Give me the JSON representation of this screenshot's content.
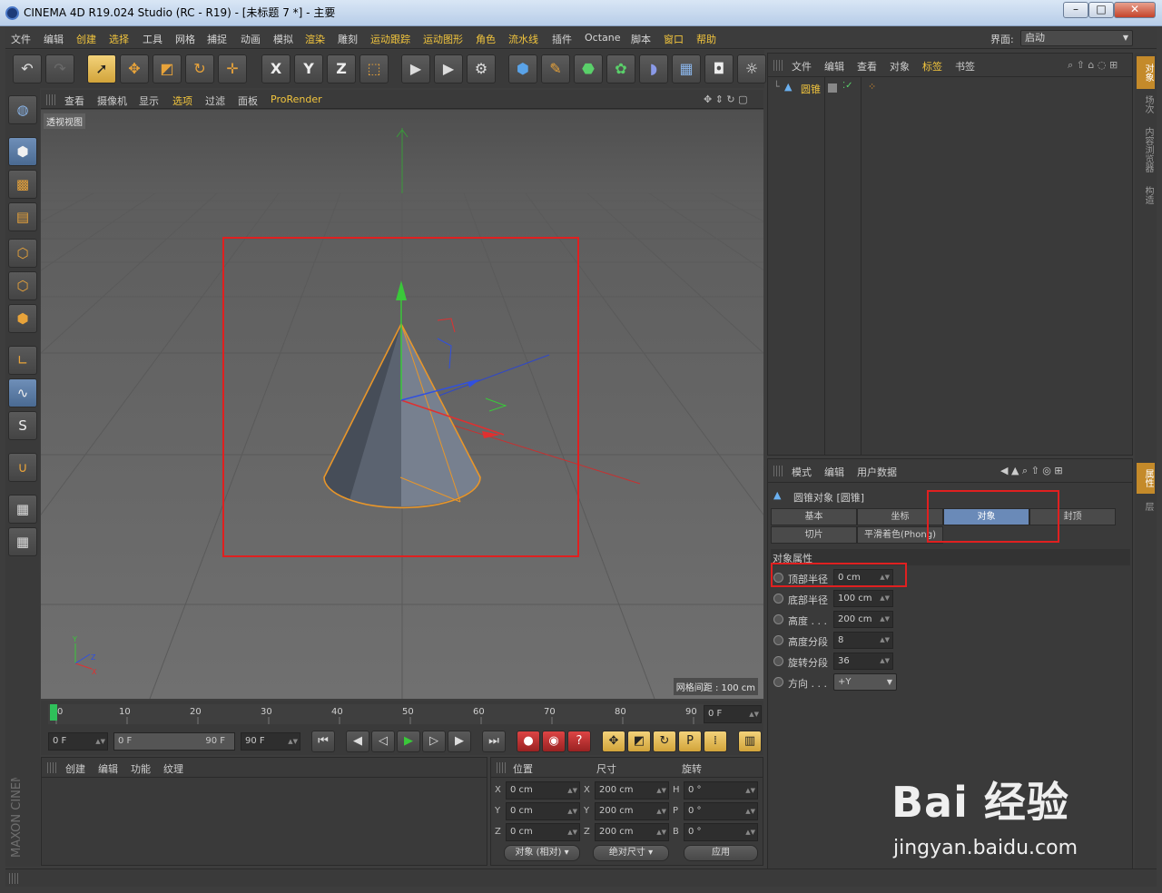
{
  "window": {
    "title": "CINEMA 4D R19.024 Studio (RC - R19) - [未标题 7 *] - 主要",
    "minimize": "–",
    "maximize": "□",
    "close": "✕"
  },
  "menubar": {
    "items": [
      {
        "label": "文件"
      },
      {
        "label": "编辑"
      },
      {
        "label": "创建"
      },
      {
        "label": "选择"
      },
      {
        "label": "工具"
      },
      {
        "label": "网格"
      },
      {
        "label": "捕捉"
      },
      {
        "label": "动画"
      },
      {
        "label": "模拟"
      },
      {
        "label": "渲染"
      },
      {
        "label": "雕刻"
      },
      {
        "label": "运动跟踪"
      },
      {
        "label": "运动图形"
      },
      {
        "label": "角色"
      },
      {
        "label": "流水线"
      },
      {
        "label": "插件"
      },
      {
        "label": "Octane"
      },
      {
        "label": "脚本"
      },
      {
        "label": "窗口"
      },
      {
        "label": "帮助"
      }
    ],
    "layout_label": "界面:",
    "layout_value": "启动"
  },
  "toolbar": {
    "icons": [
      "undo-icon",
      "redo-icon",
      "live-select-icon",
      "move-icon",
      "scale-icon",
      "rotate-icon",
      "recent-tool-icon",
      "x-axis-icon",
      "y-axis-icon",
      "z-axis-icon",
      "coordinate-system-icon",
      "render-view-icon",
      "render-picture-viewer-icon",
      "render-settings-icon",
      "cube-icon",
      "pen-icon",
      "subdivision-icon",
      "mograph-cloner-icon",
      "deformer-icon",
      "floor-icon",
      "camera-icon",
      "light-icon"
    ],
    "axis_labels": {
      "x": "X",
      "y": "Y",
      "z": "Z"
    }
  },
  "viewport": {
    "menu": [
      "查看",
      "摄像机",
      "显示",
      "选项",
      "过滤",
      "面板",
      "ProRender"
    ],
    "view_name": "透视视图",
    "grid_spacing": "网格间距 : 100 cm",
    "axis_labels": {
      "x": "X",
      "y": "Y",
      "z": "Z"
    }
  },
  "timeline": {
    "ticks": [
      "0",
      "10",
      "20",
      "30",
      "40",
      "50",
      "60",
      "70",
      "80",
      "90"
    ],
    "current_frame": "0 F"
  },
  "playback": {
    "start": "0 F",
    "range_start": "0 F",
    "range_end": "90 F",
    "end": "90 F"
  },
  "material_panel": {
    "menu": [
      "创建",
      "编辑",
      "功能",
      "纹理"
    ]
  },
  "coordinates": {
    "headers": {
      "position": "位置",
      "size": "尺寸",
      "rotation": "旋转"
    },
    "rows": [
      {
        "axis": "X",
        "pos": "0 cm",
        "size_axis": "X",
        "size": "200 cm",
        "rot_axis": "H",
        "rot": "0 °"
      },
      {
        "axis": "Y",
        "pos": "0 cm",
        "size_axis": "Y",
        "size": "200 cm",
        "rot_axis": "P",
        "rot": "0 °"
      },
      {
        "axis": "Z",
        "pos": "0 cm",
        "size_axis": "Z",
        "size": "200 cm",
        "rot_axis": "B",
        "rot": "0 °"
      }
    ],
    "mode": "对象 (相对)",
    "size_mode": "绝对尺寸",
    "apply": "应用"
  },
  "object_manager": {
    "menu": [
      "文件",
      "编辑",
      "查看",
      "对象",
      "标签",
      "书签"
    ],
    "objects": [
      {
        "name": "圆锥"
      }
    ]
  },
  "attributes": {
    "menu": [
      "模式",
      "编辑",
      "用户数据"
    ],
    "object_title": "圆锥对象 [圆锥]",
    "tabs_row1": [
      "基本",
      "坐标",
      "对象",
      "封顶"
    ],
    "tabs_row2": [
      "切片",
      "平滑着色(Phong)"
    ],
    "active_tab": "对象",
    "section": "对象属性",
    "properties": [
      {
        "label": "顶部半径",
        "value": "0 cm"
      },
      {
        "label": "底部半径",
        "value": "100 cm"
      },
      {
        "label": "高度 . . .",
        "value": "200 cm"
      },
      {
        "label": "高度分段",
        "value": "8"
      },
      {
        "label": "旋转分段",
        "value": "36"
      },
      {
        "label": "方向 . . .",
        "value": "+Y"
      }
    ]
  },
  "right_tabs": [
    "对象",
    "场次",
    "内容浏览器",
    "构造"
  ],
  "right_tabs_lower": [
    "属性",
    "层"
  ],
  "brand_vertical": "MAXON CINEMA 4D",
  "watermark": {
    "brand": "Bai 经验",
    "url": "jingyan.baidu.com"
  },
  "colors": {
    "accent_yellow": "#f2c53d",
    "highlight_red": "#e02020",
    "cone_outline": "#e8962a",
    "active_tab": "#6a8ab8"
  }
}
